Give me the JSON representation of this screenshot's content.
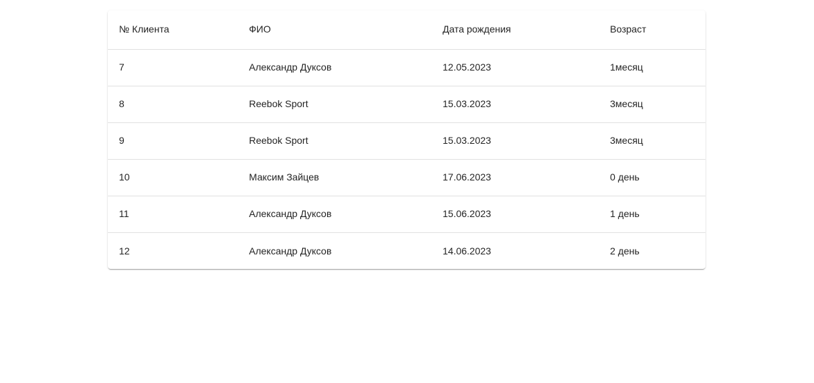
{
  "table": {
    "headers": [
      "№ Клиента",
      "ФИО",
      "Дата рождения",
      "Возраст"
    ],
    "rows": [
      [
        "7",
        "Александр Дуксов",
        "12.05.2023",
        "1месяц"
      ],
      [
        "8",
        "Reebok Sport",
        "15.03.2023",
        "3месяц"
      ],
      [
        "9",
        "Reebok Sport",
        "15.03.2023",
        "3месяц"
      ],
      [
        "10",
        "Максим Зайцев",
        "17.06.2023",
        "0 день"
      ],
      [
        "11",
        "Александр Дуксов",
        "15.06.2023",
        "1 день"
      ],
      [
        "12",
        "Александр Дуксов",
        "14.06.2023",
        "2 день"
      ]
    ]
  }
}
